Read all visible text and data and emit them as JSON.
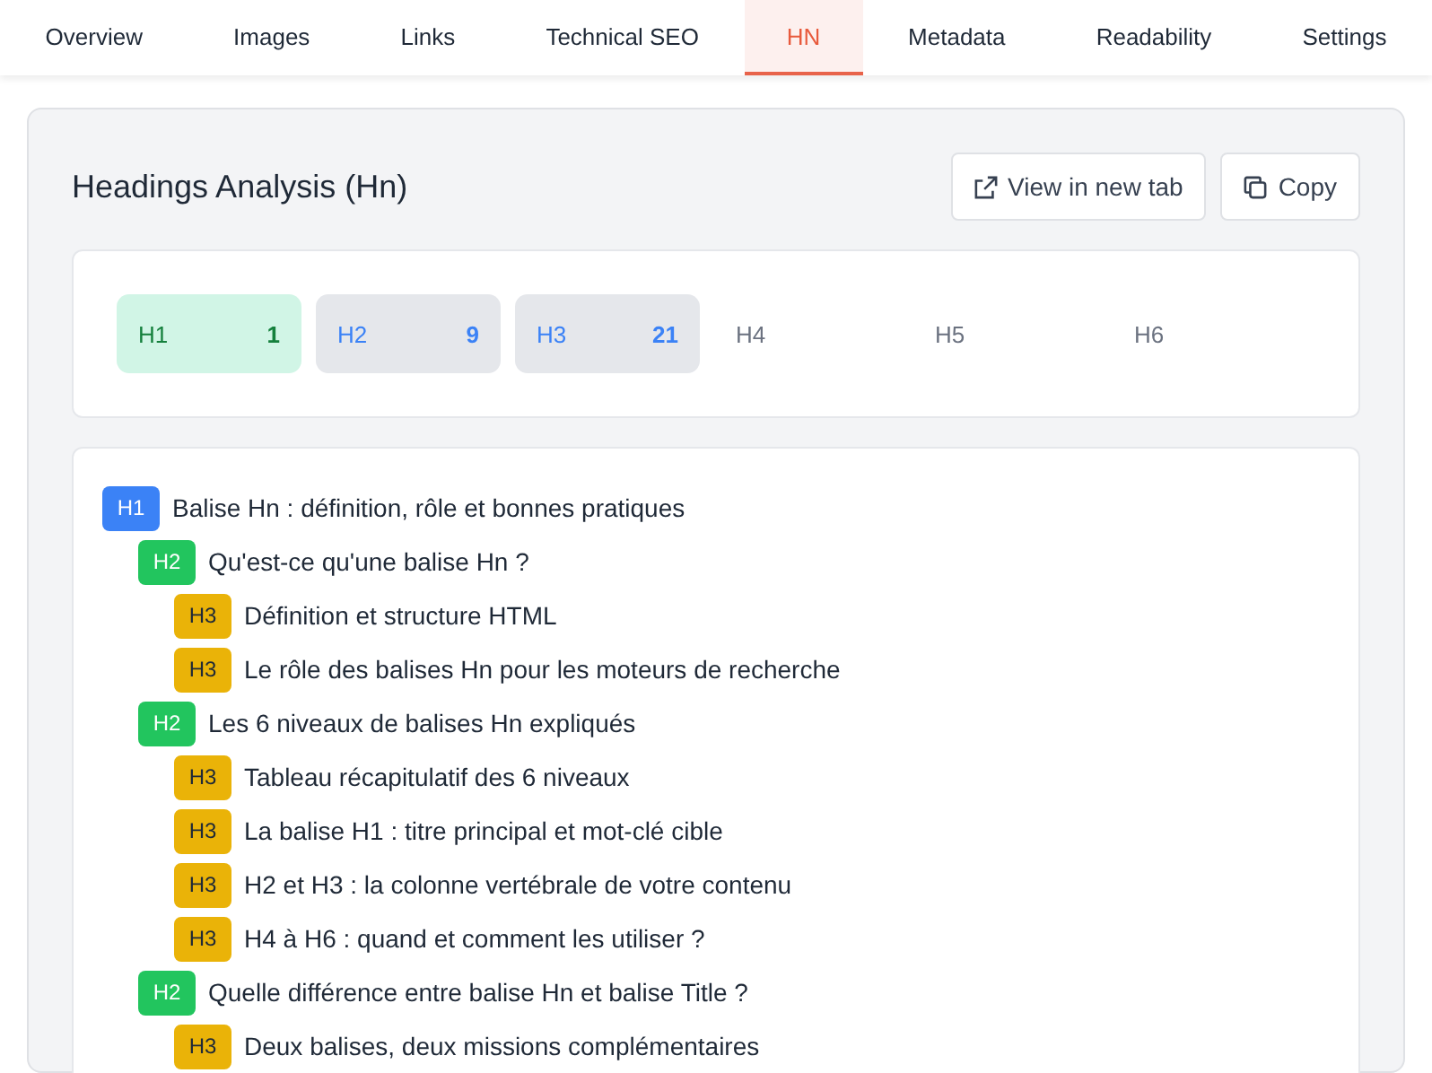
{
  "tabs": [
    {
      "label": "Overview",
      "selected": false
    },
    {
      "label": "Images",
      "selected": false
    },
    {
      "label": "Links",
      "selected": false
    },
    {
      "label": "Technical SEO",
      "selected": false
    },
    {
      "label": "HN",
      "selected": true
    },
    {
      "label": "Metadata",
      "selected": false
    },
    {
      "label": "Readability",
      "selected": false
    },
    {
      "label": "Settings",
      "selected": false
    }
  ],
  "panel": {
    "title": "Headings Analysis (Hn)",
    "buttons": [
      {
        "label": "View in new tab",
        "kind": "external"
      },
      {
        "label": "Copy",
        "kind": "copy"
      }
    ]
  },
  "levels": [
    {
      "label": "H1",
      "count": "1",
      "kind": "ok"
    },
    {
      "label": "H2",
      "count": "9",
      "kind": "present"
    },
    {
      "label": "H3",
      "count": "21",
      "kind": "present"
    },
    {
      "label": "H4",
      "kind": "empty"
    },
    {
      "label": "H5",
      "kind": "empty"
    },
    {
      "label": "H6",
      "kind": "empty"
    }
  ],
  "headings": [
    {
      "tag": "H1",
      "color": "#3b82f6",
      "text": "Balise Hn : définition, rôle et bonnes pratiques",
      "children": [
        {
          "tag": "H2",
          "color": "#22c55e",
          "text": "Qu'est-ce qu'une balise Hn ?",
          "children": [
            {
              "tag": "H3",
              "color": "#eab308",
              "text": "Définition et structure HTML"
            },
            {
              "tag": "H3",
              "color": "#eab308",
              "text": "Le rôle des balises Hn pour les moteurs de recherche"
            }
          ]
        },
        {
          "tag": "H2",
          "color": "#22c55e",
          "text": "Les 6 niveaux de balises Hn expliqués",
          "children": [
            {
              "tag": "H3",
              "color": "#eab308",
              "text": "Tableau récapitulatif des 6 niveaux"
            },
            {
              "tag": "H3",
              "color": "#eab308",
              "text": "La balise H1 : titre principal et mot-clé cible"
            },
            {
              "tag": "H3",
              "color": "#eab308",
              "text": "H2 et H3 : la colonne vertébrale de votre contenu"
            },
            {
              "tag": "H3",
              "color": "#eab308",
              "text": "H4 à H6 : quand et comment les utiliser ?"
            }
          ]
        },
        {
          "tag": "H2",
          "color": "#22c55e",
          "text": "Quelle différence entre balise Hn et balise Title ?",
          "children": [
            {
              "tag": "H3",
              "color": "#eab308",
              "text": "Deux balises, deux missions complémentaires"
            }
          ]
        }
      ]
    }
  ]
}
